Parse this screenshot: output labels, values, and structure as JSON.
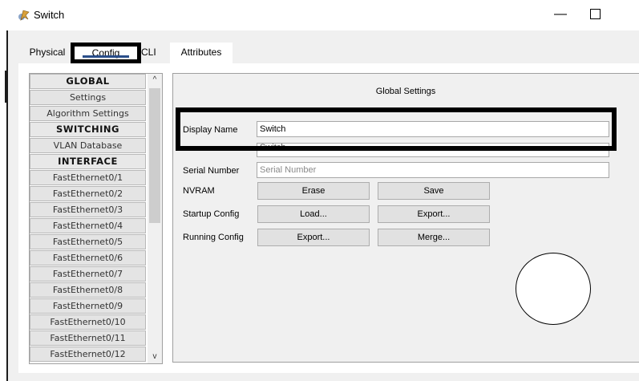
{
  "window": {
    "title": "Switch",
    "minimize_label": "—"
  },
  "tabs": [
    {
      "label": "Physical"
    },
    {
      "label": "Config"
    },
    {
      "label": "CLI"
    },
    {
      "label": "Attributes"
    }
  ],
  "sidebar": {
    "items": [
      {
        "label": "GLOBAL",
        "header": true
      },
      {
        "label": "Settings"
      },
      {
        "label": "Algorithm Settings"
      },
      {
        "label": "SWITCHING",
        "header": true
      },
      {
        "label": "VLAN Database"
      },
      {
        "label": "INTERFACE",
        "header": true
      },
      {
        "label": "FastEthernet0/1"
      },
      {
        "label": "FastEthernet0/2"
      },
      {
        "label": "FastEthernet0/3"
      },
      {
        "label": "FastEthernet0/4"
      },
      {
        "label": "FastEthernet0/5"
      },
      {
        "label": "FastEthernet0/6"
      },
      {
        "label": "FastEthernet0/7"
      },
      {
        "label": "FastEthernet0/8"
      },
      {
        "label": "FastEthernet0/9"
      },
      {
        "label": "FastEthernet0/10"
      },
      {
        "label": "FastEthernet0/11"
      },
      {
        "label": "FastEthernet0/12"
      }
    ],
    "scroll_up": "^",
    "scroll_down": "v"
  },
  "settings": {
    "title": "Global Settings",
    "display_name_label": "Display Name",
    "display_name_value": "Switch",
    "hostname_value": "Switch",
    "serial_number_label": "Serial Number",
    "serial_number_placeholder": "Serial Number",
    "nvram_label": "NVRAM",
    "erase_button": "Erase",
    "save_button": "Save",
    "startup_config_label": "Startup Config",
    "load_button": "Load...",
    "startup_export_button": "Export...",
    "running_config_label": "Running Config",
    "running_export_button": "Export...",
    "merge_button": "Merge..."
  },
  "colors": {
    "tab_underline": "#2a4e8a",
    "annotation": "#000000"
  }
}
